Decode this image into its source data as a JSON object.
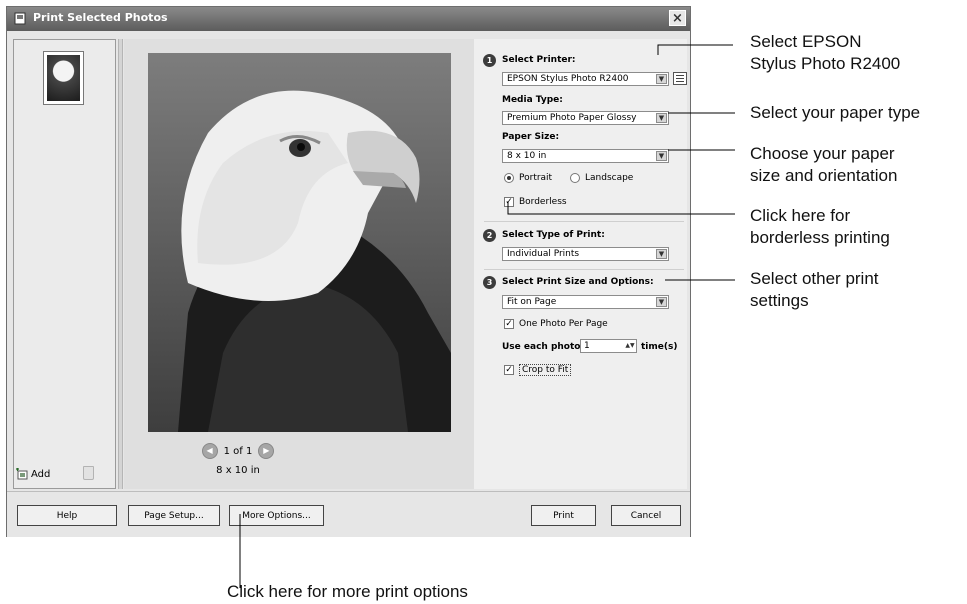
{
  "window": {
    "title": "Print Selected Photos",
    "close_glyph": "×"
  },
  "thumbnails": {
    "add_label": "Add",
    "icons": [
      "add-photo-icon",
      "trash-icon"
    ]
  },
  "preview": {
    "page_indicator": "1 of 1",
    "paper_size": "8 x 10 in",
    "prev_glyph": "◀",
    "next_glyph": "▶"
  },
  "settings": {
    "step1_label": "Select Printer:",
    "printer": "EPSON Stylus Photo R2400",
    "media_type_label": "Media Type:",
    "media_type": "Premium Photo Paper Glossy",
    "paper_size_label": "Paper Size:",
    "paper_size": "8 x 10 in",
    "portrait_label": "Portrait",
    "landscape_label": "Landscape",
    "borderless_label": "Borderless",
    "step2_label": "Select Type of Print:",
    "print_type": "Individual Prints",
    "step3_label": "Select Print Size and Options:",
    "print_size": "Fit on Page",
    "one_photo_label": "One Photo Per Page",
    "use_each_label": "Use each photo",
    "use_each_value": "1",
    "times_label": "time(s)",
    "crop_label": "Crop to Fit",
    "step_numbers": [
      "1",
      "2",
      "3"
    ]
  },
  "buttons": {
    "help": "Help",
    "page_setup": "Page Setup...",
    "more_options": "More Options...",
    "print": "Print",
    "cancel": "Cancel"
  },
  "callouts": {
    "printer_line1": "Select EPSON",
    "printer_line2": "Stylus Photo R2400",
    "paper_type": "Select your paper type",
    "size_line1": "Choose your paper",
    "size_line2": "size and orientation",
    "borderless_line1": "Click here for",
    "borderless_line2": "borderless printing",
    "other_line1": "Select other print",
    "other_line2": "settings",
    "more_options": "Click here for more print options"
  }
}
